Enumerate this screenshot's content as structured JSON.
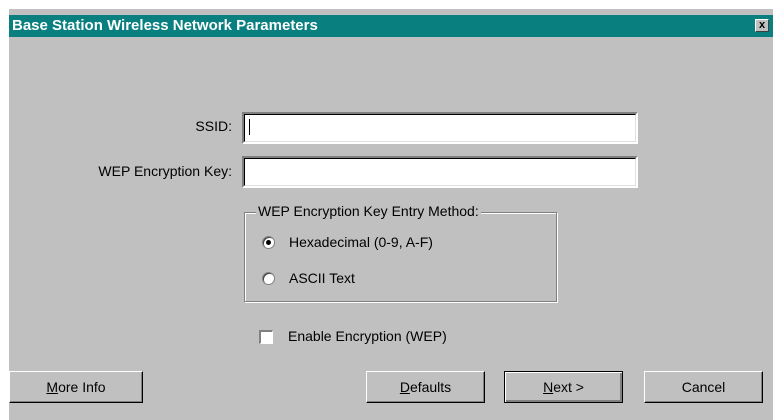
{
  "dialog": {
    "title": "Base Station Wireless Network Parameters",
    "close_label": "x"
  },
  "form": {
    "ssid_label": "SSID:",
    "ssid_value": "",
    "wep_key_label": "WEP Encryption Key:",
    "wep_key_value": ""
  },
  "entry_method": {
    "group_label": "WEP Encryption Key Entry Method:",
    "options": [
      {
        "label": "Hexadecimal (0-9, A-F)",
        "selected": true
      },
      {
        "label": "ASCII Text",
        "selected": false
      }
    ]
  },
  "encryption": {
    "checkbox_label": "Enable Encryption (WEP)",
    "checked": false
  },
  "buttons": {
    "more_info": {
      "accel": "M",
      "rest": "ore Info"
    },
    "defaults": {
      "accel": "D",
      "rest": "efaults"
    },
    "next": {
      "accel": "N",
      "rest": "ext >"
    },
    "cancel": "Cancel"
  },
  "colors": {
    "title_bar": "#0a7f80",
    "dialog_bg": "#c0c0c0"
  }
}
